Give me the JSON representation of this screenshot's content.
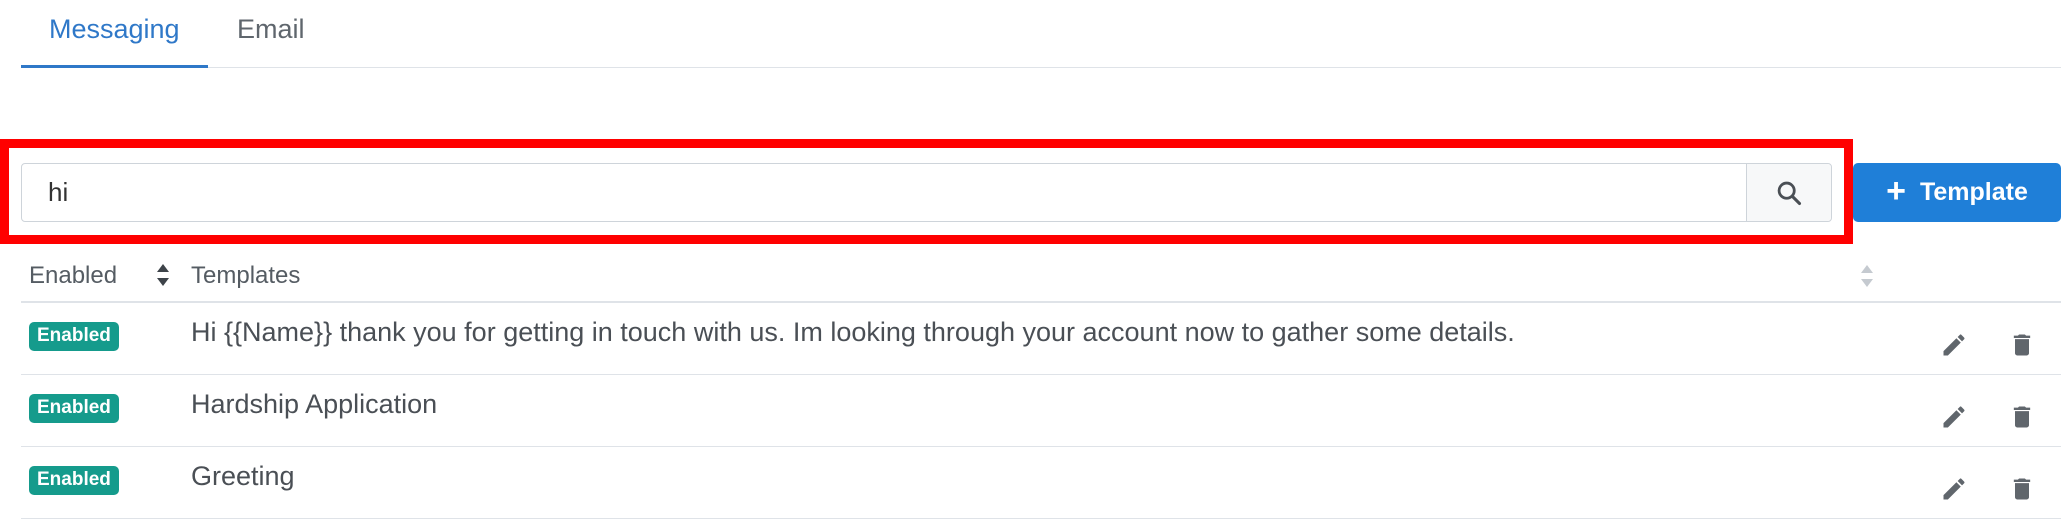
{
  "tabs": [
    {
      "label": "Messaging",
      "active": true
    },
    {
      "label": "Email",
      "active": false
    }
  ],
  "search": {
    "value": "hi",
    "placeholder": "",
    "button_icon": "search-icon"
  },
  "toolbar": {
    "add_label": "Template",
    "add_icon": "plus-icon"
  },
  "table": {
    "columns": [
      "Enabled",
      "Templates"
    ],
    "rows": [
      {
        "status": "Enabled",
        "template": "Hi {{Name}} thank you for getting in touch with us. Im looking through your account now to gather some details."
      },
      {
        "status": "Enabled",
        "template": "Hardship Application"
      },
      {
        "status": "Enabled",
        "template": "Greeting"
      }
    ]
  },
  "colors": {
    "accent": "#2f78c8",
    "primary_button": "#1f7fd8",
    "badge": "#159b8c",
    "highlight": "#ff0000"
  }
}
